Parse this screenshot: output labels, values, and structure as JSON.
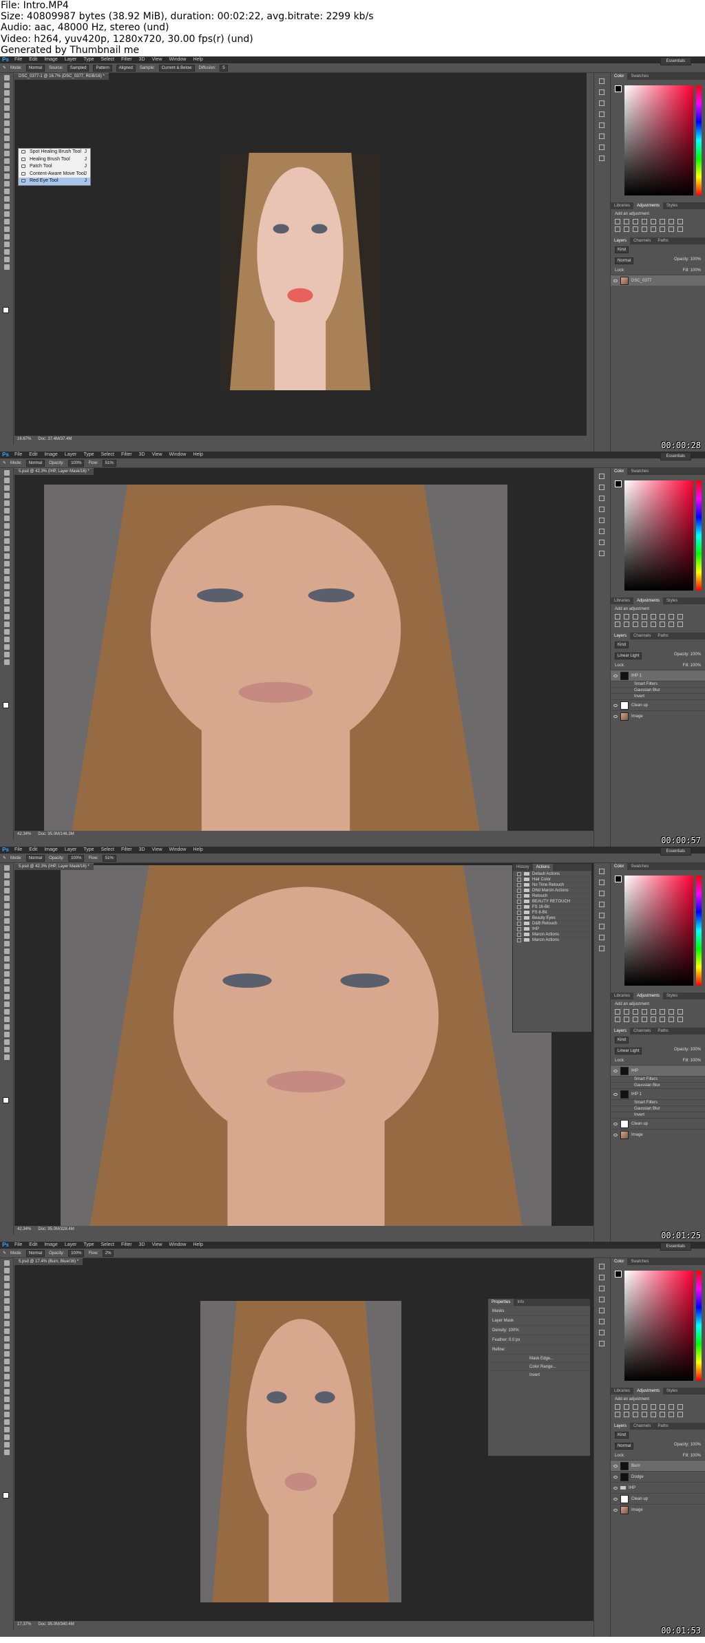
{
  "header": {
    "file": "File: Intro.MP4",
    "size": "Size: 40809987 bytes (38.92 MiB), duration: 00:02:22, avg.bitrate: 2299 kb/s",
    "audio": "Audio: aac, 48000 Hz, stereo (und)",
    "video": "Video: h264, yuv420p, 1280x720, 30.00 fps(r) (und)",
    "generated": "Generated by Thumbnail me"
  },
  "app": {
    "logo": "Ps",
    "menu": [
      "File",
      "Edit",
      "Image",
      "Layer",
      "Type",
      "Select",
      "Filter",
      "3D",
      "View",
      "Window",
      "Help"
    ],
    "workspace": "Essentials"
  },
  "panel_labels": {
    "color_tabs": [
      "Color",
      "Swatches"
    ],
    "adj_tabs": [
      "Libraries",
      "Adjustments",
      "Styles"
    ],
    "add_adjustment": "Add an adjustment",
    "layer_tabs": [
      "Layers",
      "Channels",
      "Paths"
    ],
    "kind": "Kind",
    "opacity": "Opacity:",
    "fill": "Fill:",
    "lock": "Lock:"
  },
  "frames": [
    {
      "timestamp": "00:00:28",
      "doc_tab": "DSC_0377-1 @ 16.7% (DSC_0377, RGB/16) *",
      "options": [
        "Mode:",
        "Normal",
        "Source:",
        "Sampled",
        "Pattern",
        "Aligned",
        "Sample:",
        "Current & Below",
        "Diffusion:",
        "5"
      ],
      "status": [
        "16.67%",
        "Doc: 37.4M/37.4M"
      ],
      "blend": "Normal",
      "opacity_value": "100%",
      "fill_value": "100%",
      "flyout": [
        {
          "label": "Spot Healing Brush Tool",
          "key": "J"
        },
        {
          "label": "Healing Brush Tool",
          "key": "J"
        },
        {
          "label": "Patch Tool",
          "key": "J"
        },
        {
          "label": "Content-Aware Move Tool",
          "key": "J"
        },
        {
          "label": "Red Eye Tool",
          "key": "J"
        }
      ],
      "layers": [
        {
          "name": "DSC_0377",
          "thumb": "img",
          "selected": true
        }
      ]
    },
    {
      "timestamp": "00:00:57",
      "doc_tab": "5.psd @ 42.3% (IHP, Layer Mask/16) *",
      "options": [
        "Mode:",
        "Normal",
        "Opacity:",
        "100%",
        "Flow:",
        "51%"
      ],
      "status": [
        "42.34%",
        "Doc: 95.0M/146.3M"
      ],
      "blend": "Linear Light",
      "opacity_value": "100%",
      "fill_value": "100%",
      "layers": [
        {
          "name": "IHP 1",
          "thumb": "dark",
          "selected": true
        },
        {
          "name": "Smart Filters",
          "sub": true
        },
        {
          "name": "Gaussian Blur",
          "sub": true
        },
        {
          "name": "Invert",
          "sub": true
        },
        {
          "name": "Clean up",
          "thumb": "white"
        },
        {
          "name": "Image",
          "thumb": "img"
        }
      ]
    },
    {
      "timestamp": "00:01:25",
      "doc_tab": "5.psd @ 42.3% (IHP, Layer Mask/16) *",
      "options": [
        "Mode:",
        "Normal",
        "Opacity:",
        "100%",
        "Flow:",
        "51%"
      ],
      "status": [
        "42.34%",
        "Doc: 95.0M/328.4M"
      ],
      "blend": "Linear Light",
      "opacity_value": "100%",
      "fill_value": "100%",
      "actions_tabs": [
        "History",
        "Actions"
      ],
      "actions": [
        "Default Actions",
        "Hair Color",
        "No Time Retouch",
        "DNd Marcin Actions",
        "Retouch",
        "BEAUTY RETOUCH",
        "FS 16-Bit",
        "FS 8-Bit",
        "Beauty Eyes",
        "D&B Retouch",
        "IHP",
        "Marcin Actions",
        "Marcin Actions"
      ],
      "layers": [
        {
          "name": "IHP",
          "thumb": "dark",
          "selected": true
        },
        {
          "name": "Smart Filters",
          "sub": true
        },
        {
          "name": "Gaussian Blur",
          "sub": true
        },
        {
          "name": "IHP 1",
          "thumb": "dark"
        },
        {
          "name": "Smart Filters",
          "sub": true
        },
        {
          "name": "Gaussian Blur",
          "sub": true
        },
        {
          "name": "Invert",
          "sub": true
        },
        {
          "name": "Clean up",
          "thumb": "white"
        },
        {
          "name": "Image",
          "thumb": "img"
        }
      ]
    },
    {
      "timestamp": "00:01:53",
      "doc_tab": "5.psd @ 17.4% (Burn, Blue/16) *",
      "options": [
        "Mode:",
        "Normal",
        "Opacity:",
        "100%",
        "Flow:",
        "2%"
      ],
      "status": [
        "17.37%",
        "Doc: 95.0M/340.4M"
      ],
      "blend": "Normal",
      "opacity_value": "100%",
      "fill_value": "100%",
      "properties": {
        "tabs": [
          "Properties",
          "Info"
        ],
        "title": "Masks",
        "mask": "Layer Mask",
        "density_label": "Density:",
        "density": "100%",
        "feather_label": "Feather:",
        "feather": "0.0 px",
        "refine_label": "Refine:",
        "buttons": [
          "Mask Edge...",
          "Color Range...",
          "Invert"
        ]
      },
      "layers": [
        {
          "name": "Burn",
          "thumb": "dark",
          "selected": true
        },
        {
          "name": "Dodge",
          "thumb": "dark"
        },
        {
          "name": "IHP",
          "thumb": "folder"
        },
        {
          "name": "Clean up",
          "thumb": "white"
        },
        {
          "name": "Image",
          "thumb": "img"
        }
      ]
    }
  ]
}
